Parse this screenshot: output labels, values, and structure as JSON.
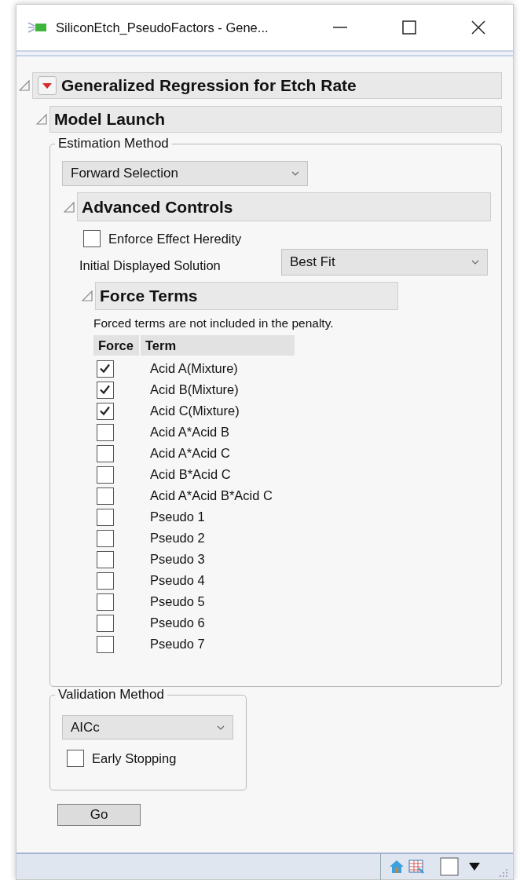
{
  "window": {
    "title": "SiliconEtch_PseudoFactors - Gene..."
  },
  "report": {
    "title": "Generalized Regression for Etch Rate",
    "expanded": true,
    "model_launch": {
      "title": "Model Launch",
      "expanded": true,
      "estimation_method": {
        "label": "Estimation Method",
        "value": "Forward Selection"
      },
      "advanced_controls": {
        "title": "Advanced Controls",
        "expanded": true,
        "enforce_effect_heredity": {
          "label": "Enforce Effect Heredity",
          "checked": false
        },
        "initial_displayed_solution": {
          "label": "Initial Displayed Solution",
          "value": "Best Fit"
        },
        "force_terms": {
          "title": "Force Terms",
          "expanded": true,
          "note": "Forced terms are not included in the penalty.",
          "columns": [
            "Force",
            "Term"
          ],
          "rows": [
            {
              "term": "Acid A(Mixture)",
              "checked": true
            },
            {
              "term": "Acid B(Mixture)",
              "checked": true
            },
            {
              "term": "Acid C(Mixture)",
              "checked": true
            },
            {
              "term": "Acid A*Acid B",
              "checked": false
            },
            {
              "term": "Acid A*Acid C",
              "checked": false
            },
            {
              "term": "Acid B*Acid C",
              "checked": false
            },
            {
              "term": "Acid A*Acid B*Acid C",
              "checked": false
            },
            {
              "term": "Pseudo 1",
              "checked": false
            },
            {
              "term": "Pseudo 2",
              "checked": false
            },
            {
              "term": "Pseudo 3",
              "checked": false
            },
            {
              "term": "Pseudo 4",
              "checked": false
            },
            {
              "term": "Pseudo 5",
              "checked": false
            },
            {
              "term": "Pseudo 6",
              "checked": false
            },
            {
              "term": "Pseudo 7",
              "checked": false
            }
          ]
        }
      },
      "validation_method": {
        "label": "Validation Method",
        "value": "AICc",
        "early_stopping": {
          "label": "Early Stopping",
          "checked": false
        }
      },
      "go_button": "Go"
    }
  }
}
